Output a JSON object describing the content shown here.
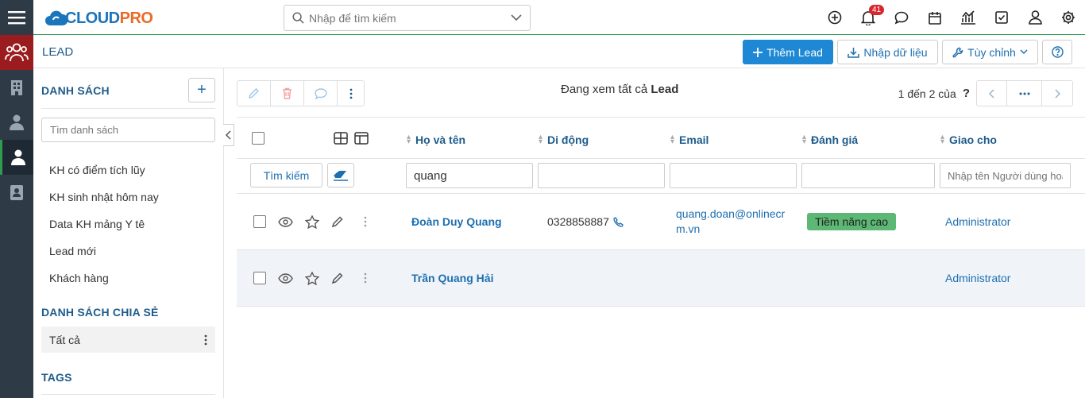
{
  "app": {
    "logo_main": "CLOUD",
    "logo_accent": "PRO"
  },
  "search": {
    "placeholder": "Nhập để tìm kiếm"
  },
  "notifications": {
    "count": "41"
  },
  "module": {
    "title": "LEAD",
    "add_label": "Thêm Lead",
    "import_label": "Nhập dữ liệu",
    "customize_label": "Tùy chỉnh"
  },
  "sidebar": {
    "list_heading": "DANH SÁCH",
    "search_placeholder": "Tìm danh sách",
    "items": [
      "KH có điểm tích lũy",
      "KH sinh nhật hôm nay",
      "Data KH mảng Y tê",
      "Lead mới",
      "Khách hàng"
    ],
    "shared_heading": "DANH SÁCH CHIA SẺ",
    "shared_items": [
      "Tất cả"
    ],
    "tags_heading": "TAGS"
  },
  "list": {
    "viewing_prefix": "Đang xem tất cả",
    "viewing_module": "Lead",
    "paging_text": "1 đến 2 của",
    "paging_unknown": "?",
    "columns": [
      "Họ và tên",
      "Di động",
      "Email",
      "Đánh giá",
      "Giao cho"
    ],
    "search_button": "Tìm kiếm",
    "filter_name_value": "quang",
    "filter_assignee_placeholder": "Nhập tên Người dùng hoặc",
    "rows": [
      {
        "name": "Đoàn Duy Quang",
        "mobile": "0328858887",
        "email": "quang.doan@onlinecrm.vn",
        "rating": "Tiềm năng cao",
        "assignee": "Administrator"
      },
      {
        "name": "Trần Quang Hải",
        "mobile": "",
        "email": "",
        "rating": "",
        "assignee": "Administrator"
      }
    ]
  },
  "colors": {
    "accent": "#1e88d4",
    "rail": "#2e3a46",
    "rail_active": "#9b1c1f",
    "rating": "#5cb874"
  }
}
